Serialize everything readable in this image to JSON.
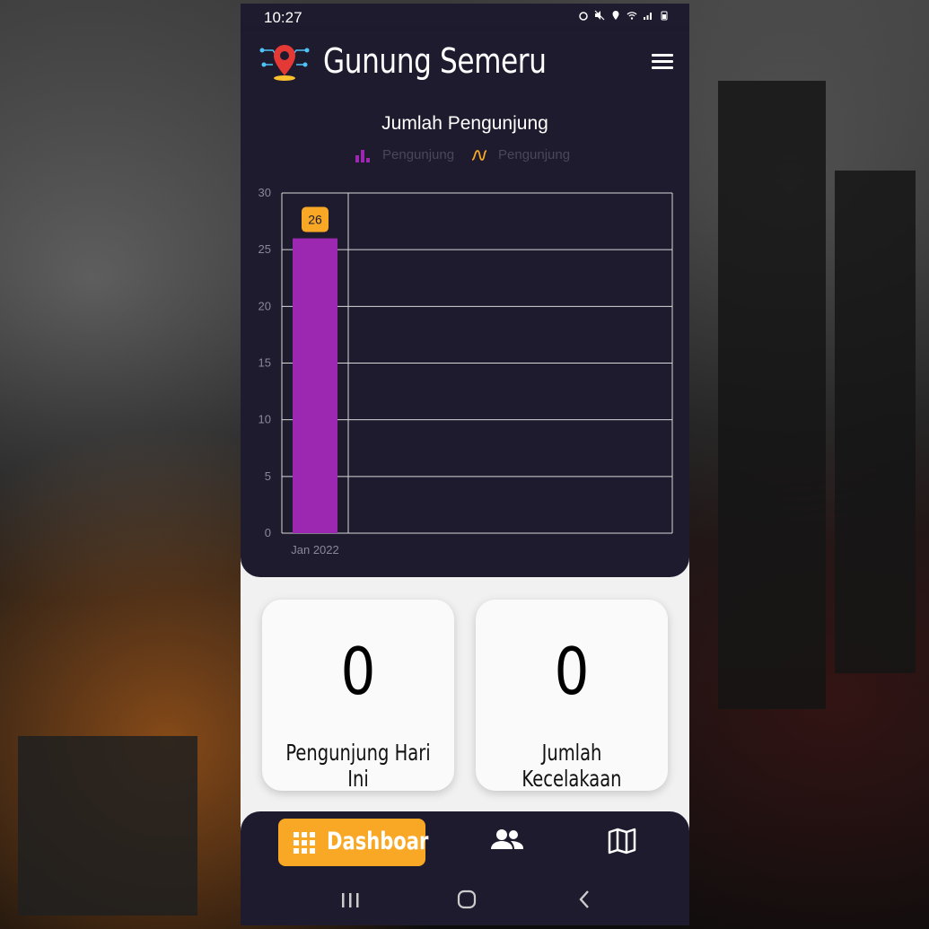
{
  "statusbar": {
    "time": "10:27"
  },
  "app": {
    "title": "Gunung Semeru"
  },
  "chart_data": {
    "type": "bar",
    "title": "Jumlah Pengunjung",
    "categories": [
      "Jan 2022"
    ],
    "series": [
      {
        "name": "Pengunjung",
        "type": "bar",
        "values": [
          26
        ],
        "color": "#9c27b0"
      },
      {
        "name": "Pengunjung",
        "type": "line",
        "values": [
          26
        ],
        "color": "#f9a825"
      }
    ],
    "data_labels": [
      "26"
    ],
    "ylim": [
      0,
      30
    ],
    "yticks": [
      0,
      5,
      10,
      15,
      20,
      25,
      30
    ],
    "grid": true,
    "legend_position": "top"
  },
  "stats": [
    {
      "value": "0",
      "label": "Pengunjung Hari Ini"
    },
    {
      "value": "0",
      "label": "Jumlah Kecelakaan"
    }
  ],
  "nav": {
    "active_label": "Dashboar",
    "icons": [
      "grid-icon",
      "people-icon",
      "map-icon"
    ]
  },
  "colors": {
    "app_dark": "#1e1b2e",
    "accent": "#f9a825",
    "bar": "#9c27b0"
  }
}
